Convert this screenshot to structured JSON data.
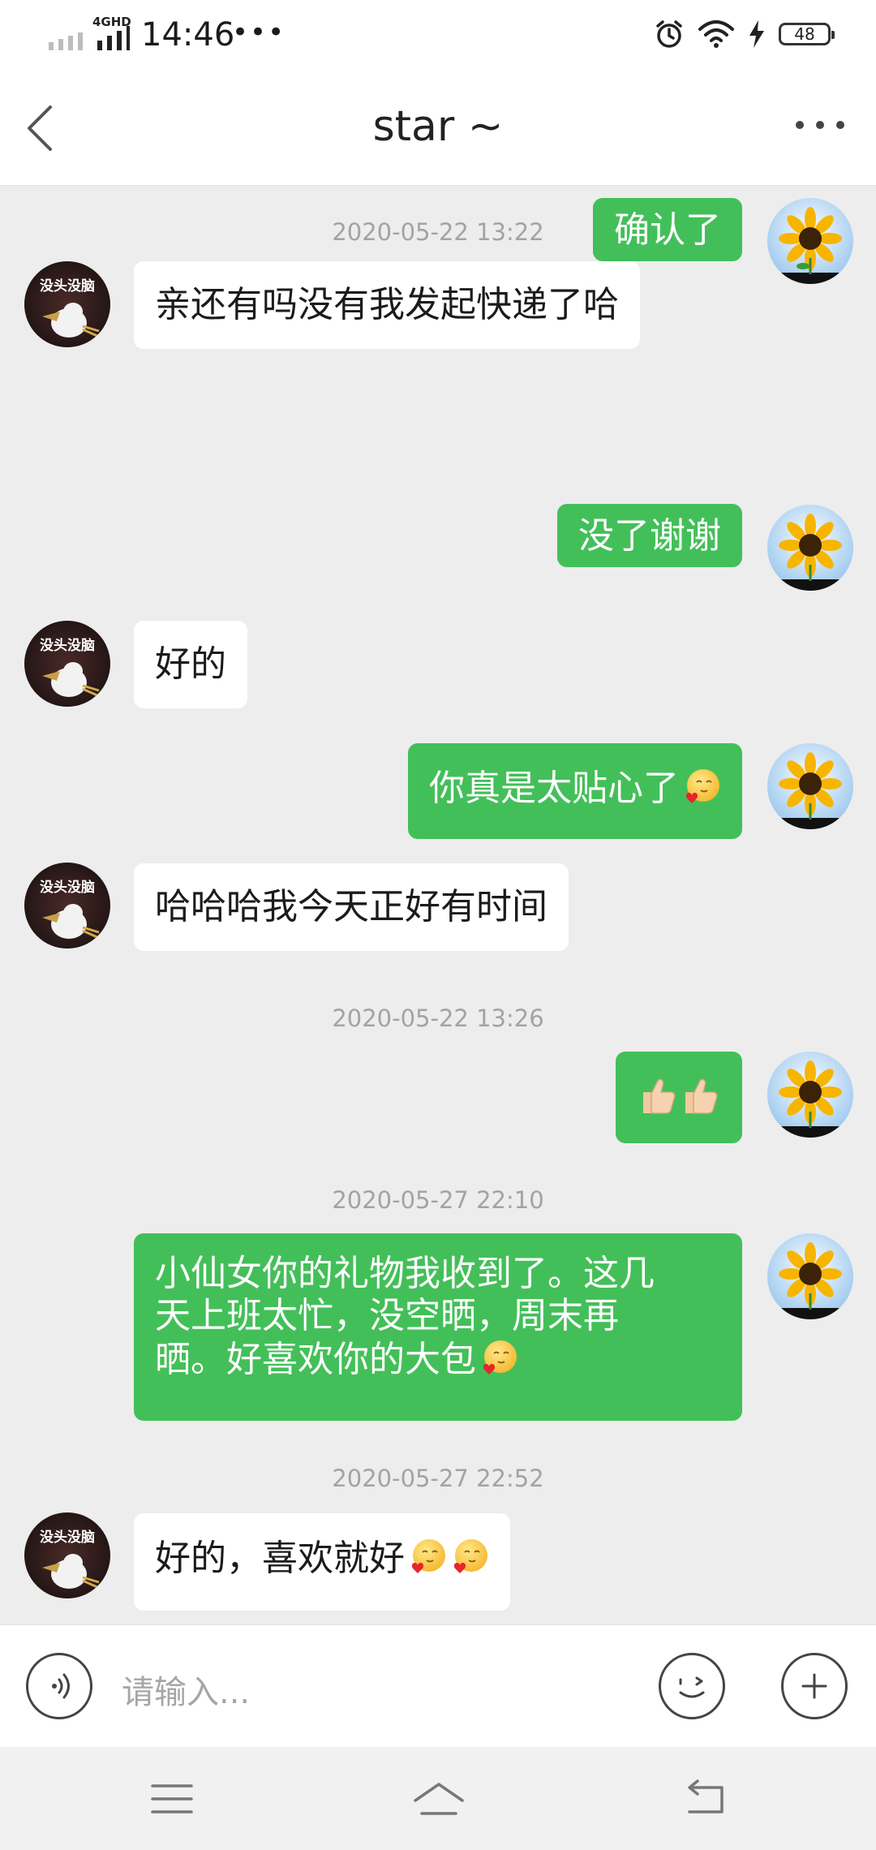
{
  "status_bar": {
    "network": "4GHD",
    "time": "14:46",
    "more_dots": "•••",
    "battery": "48",
    "icons": [
      "alarm-icon",
      "wifi-icon",
      "charging-icon",
      "battery-icon"
    ]
  },
  "header": {
    "title": "star ~",
    "back_icon": "back-chevron-icon",
    "more_icon": "more-dots-icon"
  },
  "peer": {
    "avatar_text": "没头没脑"
  },
  "messages": [
    {
      "type": "out",
      "text": "确认了"
    },
    {
      "type": "timestamp",
      "text": "2020-05-22 13:22"
    },
    {
      "type": "in",
      "text": "亲还有吗没有我发起快递了哈"
    },
    {
      "type": "out",
      "text": "没了谢谢"
    },
    {
      "type": "in",
      "text": "好的"
    },
    {
      "type": "out",
      "text": "你真是太贴心了",
      "emoji": [
        "blush-heart-emoji"
      ]
    },
    {
      "type": "in",
      "text": "哈哈哈我今天正好有时间"
    },
    {
      "type": "timestamp",
      "text": "2020-05-22 13:26"
    },
    {
      "type": "out",
      "text": "",
      "emoji": [
        "thumbs-up-emoji",
        "thumbs-up-emoji"
      ]
    },
    {
      "type": "timestamp",
      "text": "2020-05-27 22:10"
    },
    {
      "type": "out",
      "lines": [
        "小仙女你的礼物我收到了。这几",
        "天上班太忙，没空晒，周末再",
        "晒。好喜欢你的大包"
      ],
      "emoji": [
        "blush-heart-emoji"
      ]
    },
    {
      "type": "timestamp",
      "text": "2020-05-27 22:52"
    },
    {
      "type": "in",
      "text": "好的，喜欢就好",
      "emoji": [
        "blush-heart-emoji",
        "blush-heart-emoji"
      ]
    }
  ],
  "input": {
    "placeholder": "请输入..."
  },
  "colors": {
    "out_bubble": "#43bf59",
    "in_bubble": "#ffffff",
    "chat_bg": "#ededed",
    "timestamp": "#a3a3a3"
  }
}
